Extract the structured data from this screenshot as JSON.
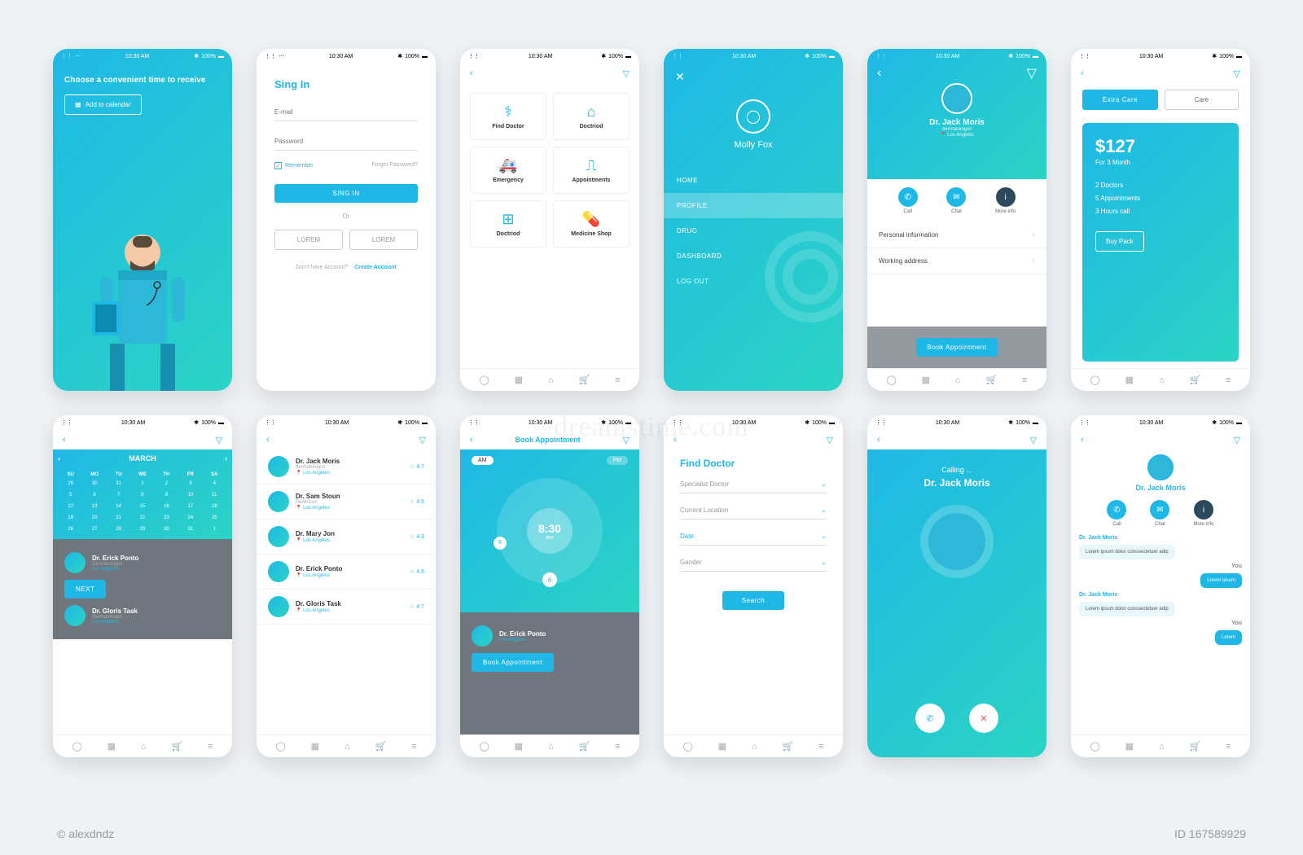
{
  "status": {
    "time": "10:30 AM",
    "battery": "100%",
    "bt": "✱"
  },
  "s1": {
    "heading": "Choose a convenient time to receive",
    "button": "Add to calendar"
  },
  "s2": {
    "title": "Sing In",
    "email": "E-mail",
    "password": "Password",
    "remember": "Remember",
    "forgot": "Forget Password?",
    "signin": "SING IN",
    "or": "Or",
    "alt": "LOREM",
    "noacct": "Don't have Account?",
    "create": "Create Account"
  },
  "s3": {
    "tiles": [
      "Find Doctor",
      "Doctriod",
      "Emergency",
      "Appointments",
      "Doctriod",
      "Medicine Shop"
    ]
  },
  "s4": {
    "name": "Molly Fox",
    "items": [
      "HOME",
      "PROFILE",
      "DRUG",
      "DASHBOARD",
      "LOG OUT"
    ]
  },
  "s5": {
    "name": "Dr. Jack Moris",
    "spec": "dermatologist",
    "loc": "Los Angeles",
    "actions": [
      "Call",
      "Chat",
      "More info"
    ],
    "rows": [
      "Personal information",
      "Working address"
    ],
    "book": "Book Appointment"
  },
  "s6": {
    "tabs": [
      "Extra Care",
      "Care"
    ],
    "price": "$127",
    "period": "For 3 Month",
    "features": [
      "2 Doctors",
      "5 Appointments",
      "3 Hours call"
    ],
    "buy": "Buy Pack"
  },
  "s7": {
    "month": "MARCH",
    "days": [
      "SU",
      "MO",
      "TU",
      "WE",
      "TH",
      "FR",
      "SA"
    ],
    "next": "NEXT",
    "docs": [
      {
        "n": "Dr. Erick Ponto",
        "s": "Dermatologist",
        "l": "Los Angeles"
      },
      {
        "n": "Dr. Gloris Task",
        "s": "Dermatologist",
        "l": "Los Angeles"
      }
    ]
  },
  "s8": {
    "docs": [
      {
        "n": "Dr. Jack Moris",
        "s": "dermatologist",
        "l": "Los Angeles",
        "r": "4.7"
      },
      {
        "n": "Dr. Sam Stoun",
        "s": "Peditrican",
        "l": "Los Angeles",
        "r": "4.5"
      },
      {
        "n": "Dr. Mary Jon",
        "s": "",
        "l": "Los Angeles",
        "r": "4.3"
      },
      {
        "n": "Dr. Erick Ponto",
        "s": "",
        "l": "Los Angeles",
        "r": "4.5"
      },
      {
        "n": "Dr. Gloris Task",
        "s": "",
        "l": "Los Angeles",
        "r": "4.7"
      }
    ]
  },
  "s9": {
    "title": "Book Appointment",
    "am": "AM",
    "pm": "PM",
    "time": "8:30",
    "suffix": "am",
    "book": "Book Appointment",
    "docs": [
      {
        "n": "Dr. Erick Ponto",
        "l": "Los Angeles"
      }
    ]
  },
  "s10": {
    "title": "Find Doctor",
    "fields": [
      "Specialist Doctor",
      "Current Location",
      "Date",
      "Gander"
    ],
    "search": "Search"
  },
  "s11": {
    "calling": "Calling ...",
    "name": "Dr. Jack Moris"
  },
  "s12": {
    "name": "Dr. Jack Moris",
    "actions": [
      "Call",
      "Chat",
      "More info"
    ],
    "msgs": [
      {
        "who": "Dr. Jack Moris",
        "t": "Lorem ipsum dolor conssectetuer adip",
        "side": "l"
      },
      {
        "who": "You",
        "t": "Lorem ipsum",
        "side": "r"
      },
      {
        "who": "Dr. Jack Moris",
        "t": "Lorem ipsum dolor conssectetuer adip",
        "side": "l"
      },
      {
        "who": "You",
        "t": "Lorem",
        "side": "r"
      }
    ]
  },
  "wm": {
    "center": "dreamstime.com",
    "id": "ID 167589929",
    "author": "© alexdndz"
  }
}
